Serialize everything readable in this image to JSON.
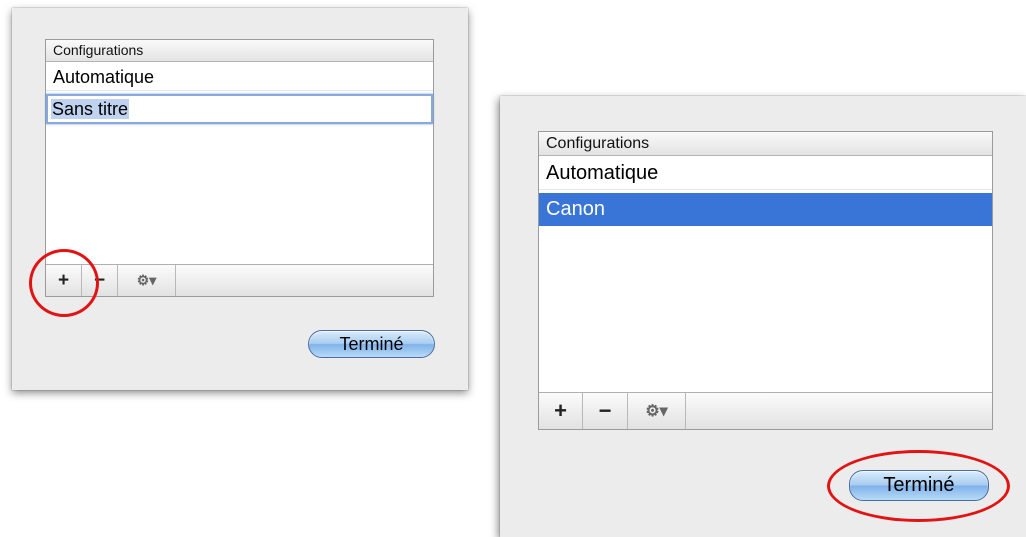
{
  "dialogs": [
    {
      "list_header": "Configurations",
      "items": [
        "Automatique",
        "Sans titre"
      ],
      "add_label": "+",
      "remove_label": "−",
      "action_label": "⚙▾",
      "done_label": "Terminé"
    },
    {
      "list_header": "Configurations",
      "items": [
        "Automatique",
        "Canon"
      ],
      "add_label": "+",
      "remove_label": "−",
      "action_label": "⚙▾",
      "done_label": "Terminé"
    }
  ],
  "colors": {
    "selection": "#3875d7",
    "highlight_ring": "#e21313"
  }
}
